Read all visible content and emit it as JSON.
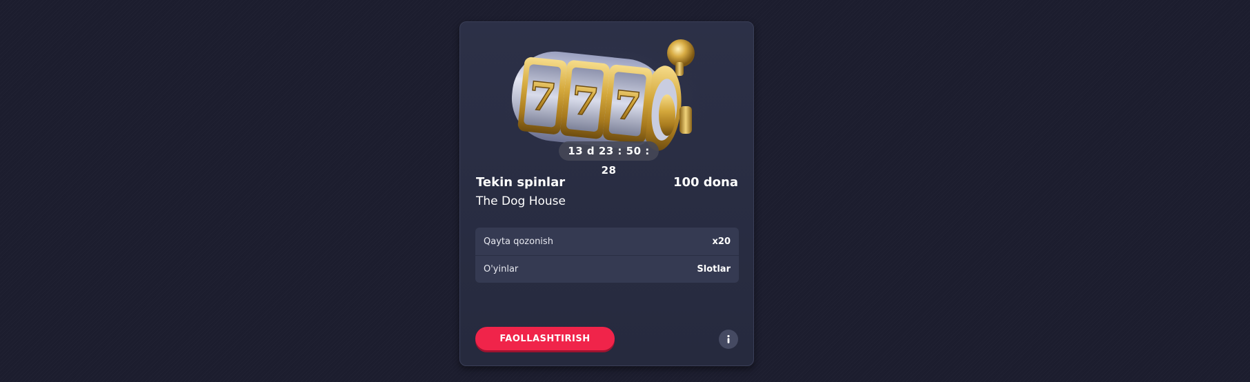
{
  "bonus": {
    "timer": "13 d 23 : 50 : 28",
    "title": "Tekin spinlar",
    "amount": "100 dona",
    "game": "The Dog House",
    "details": [
      {
        "label": "Qayta qozonish",
        "value": "x20"
      },
      {
        "label": "O'yinlar",
        "value": "Slotlar"
      }
    ],
    "activate_label": "FAOLLASHTIRISH",
    "image_icon": "slot-machine-777-icon",
    "info_icon": "info-icon"
  },
  "colors": {
    "page_background": "#1c1d2e",
    "card_background": "#2c3047",
    "accent": "#f0244a",
    "gold": "#d4a83c"
  }
}
